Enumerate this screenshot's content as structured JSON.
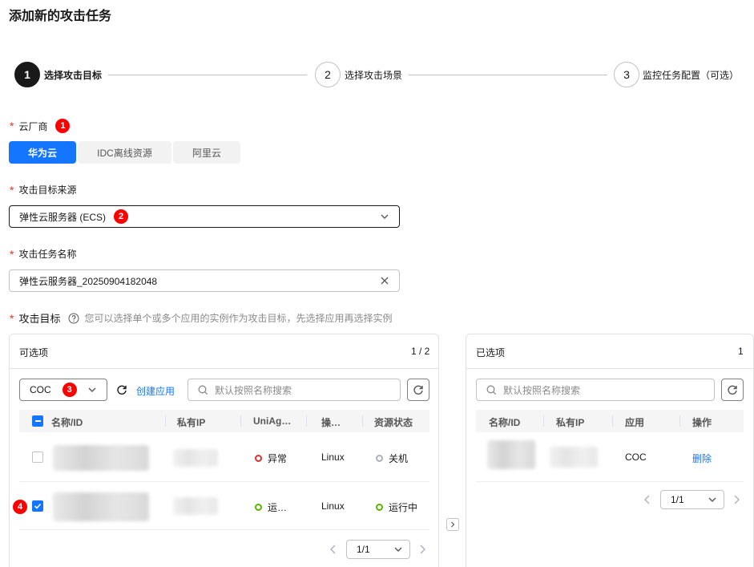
{
  "page": {
    "title": "添加新的攻击任务"
  },
  "steps": [
    {
      "num": "1",
      "label": "选择攻击目标"
    },
    {
      "num": "2",
      "label": "选择攻击场景"
    },
    {
      "num": "3",
      "label": "监控任务配置（可选）"
    }
  ],
  "markers": [
    "1",
    "2",
    "3",
    "4"
  ],
  "cloud": {
    "label": "云厂商",
    "options": [
      "华为云",
      "IDC离线资源",
      "阿里云"
    ],
    "selected": "华为云"
  },
  "source": {
    "label": "攻击目标来源",
    "value": "弹性云服务器 (ECS)"
  },
  "task_name": {
    "label": "攻击任务名称",
    "value": "弹性云服务器_20250904182048"
  },
  "targets": {
    "label": "攻击目标",
    "hint": "您可以选择单个或多个应用的实例作为攻击目标，先选择应用再选择实例"
  },
  "available": {
    "title": "可选项",
    "count": "1 / 2",
    "app_select": "COC",
    "create_app": "创建应用",
    "search_placeholder": "默认按照名称搜索",
    "columns": [
      "名称/ID",
      "私有IP",
      "UniAg…",
      "操…",
      "资源状态"
    ],
    "rows": [
      {
        "uniagent": "异常",
        "os": "Linux",
        "status": "关机",
        "checked": false
      },
      {
        "uniagent": "运…",
        "os": "Linux",
        "status": "运行中",
        "checked": true
      }
    ],
    "page": "1/1"
  },
  "selected": {
    "title": "已选项",
    "count": "1",
    "search_placeholder": "默认按照名称搜索",
    "columns": [
      "名称/ID",
      "私有IP",
      "应用",
      "操作"
    ],
    "rows": [
      {
        "app": "COC",
        "action": "删除"
      }
    ],
    "page": "1/1"
  },
  "colors": {
    "accent": "#1476ff",
    "danger": "#e0302b",
    "ok": "#5cb300",
    "off": "#adb0b8"
  }
}
